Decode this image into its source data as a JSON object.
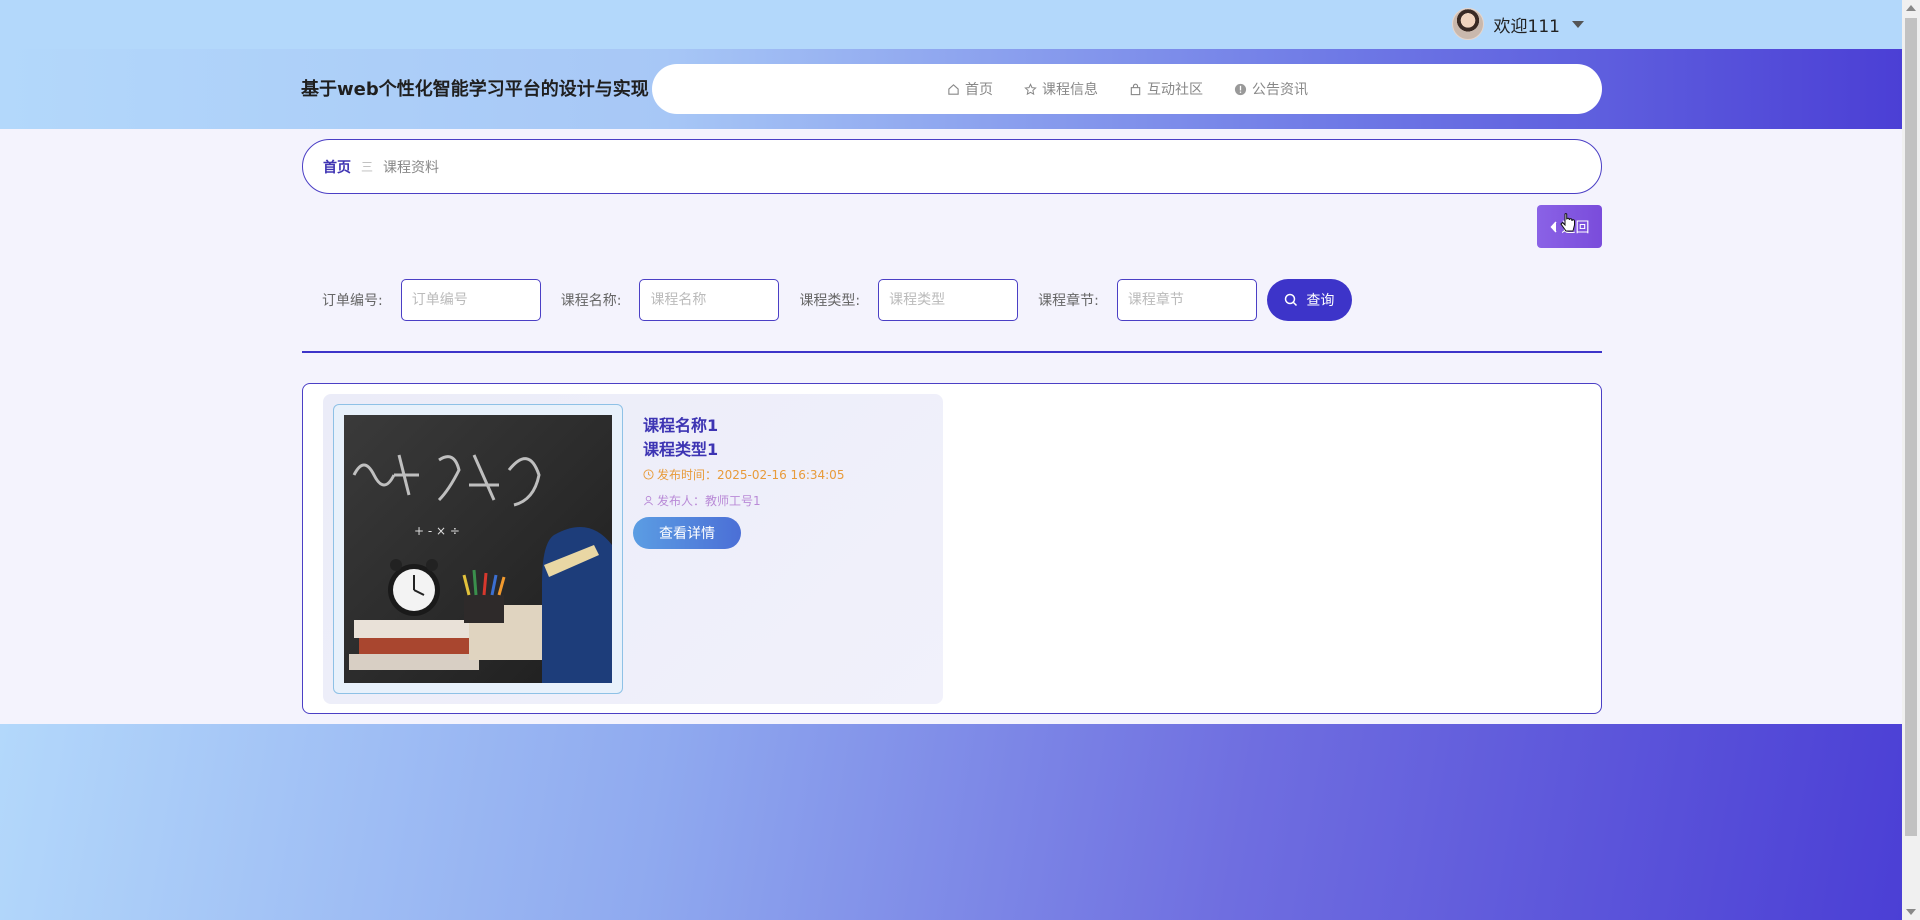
{
  "user": {
    "welcome": "欢迎111"
  },
  "site": {
    "title": "基于web个性化智能学习平台的设计与实现"
  },
  "nav": {
    "items": [
      {
        "label": "首页",
        "icon": "home-icon"
      },
      {
        "label": "课程信息",
        "icon": "star-icon"
      },
      {
        "label": "互动社区",
        "icon": "bag-icon"
      },
      {
        "label": "公告资讯",
        "icon": "info-icon"
      }
    ]
  },
  "breadcrumb": {
    "home": "首页",
    "separator": "三",
    "current": "课程资料"
  },
  "back_button": {
    "label": "返回"
  },
  "search": {
    "fields": [
      {
        "label": "订单编号:",
        "placeholder": "订单编号"
      },
      {
        "label": "课程名称:",
        "placeholder": "课程名称"
      },
      {
        "label": "课程类型:",
        "placeholder": "课程类型"
      },
      {
        "label": "课程章节:",
        "placeholder": "课程章节"
      }
    ],
    "button_label": "查询"
  },
  "courses": [
    {
      "name": "课程名称1",
      "type": "课程类型1",
      "time": "发布时间：2025-02-16 16:34:05",
      "author": "发布人：教师工号1",
      "detail_label": "查看详情"
    }
  ],
  "colors": {
    "primary": "#3d34c9",
    "accent_orange": "#e89b3a",
    "accent_purple": "#b98ad7",
    "header_gradient_start": "#b3d8fb",
    "header_gradient_end": "#4b3fd5"
  }
}
